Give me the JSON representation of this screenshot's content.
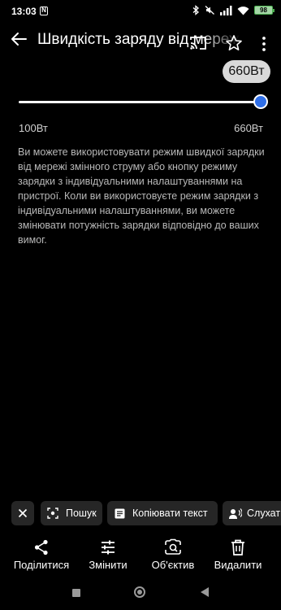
{
  "status_bar": {
    "time": "13:03",
    "nfc_label": "N",
    "battery": "98",
    "icons": [
      "nfc-icon",
      "bluetooth-icon",
      "mute-icon",
      "signal-icon",
      "wifi-icon",
      "battery-icon"
    ]
  },
  "header": {
    "title": "Швидкість заряду від мережі",
    "icons": [
      "back-arrow-icon",
      "cast-icon",
      "star-icon",
      "more-vert-icon"
    ]
  },
  "slider": {
    "current_value": "660Вт",
    "min_label": "100Вт",
    "max_label": "660Вт",
    "fraction": 1.0,
    "accent_color": "#2f6fe8"
  },
  "description": "Ви можете використовувати режим швидкої зарядки від мережі змінного струму або кнопку режиму зарядки з індивідуальними налаштуваннями на пристрої. Коли ви використовуєте режим зарядки з індивідуальними налаштуваннями, ви можете змінювати потужність зарядки відповідно до ваших вимог.",
  "chips": {
    "close_icon": "close-icon",
    "search": "Пошук",
    "copy_text": "Копіювати текст",
    "listen": "Слухати"
  },
  "actions": {
    "share": "Поділитися",
    "edit": "Змінити",
    "lens": "Об'єктив",
    "delete": "Видалити"
  }
}
